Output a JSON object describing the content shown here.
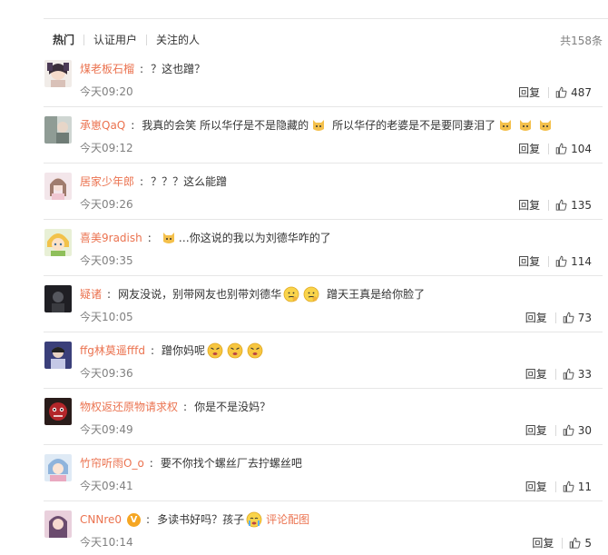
{
  "filter": {
    "tabs": [
      "热门",
      "认证用户",
      "关注的人"
    ],
    "total": "共158条"
  },
  "comments": [
    {
      "user": "煤老板石榴",
      "text": "？这也蹭？",
      "time": "今天09:20",
      "reply": "回复",
      "likes": "487"
    },
    {
      "user": "承崽QaQ",
      "text_a": "我真的会笑 所以华仔是不是隐藏的",
      "text_b": "所以华仔的老婆是不是要同妻泪了",
      "time": "今天09:12",
      "reply": "回复",
      "likes": "104"
    },
    {
      "user": "居家少年郎",
      "text": "？？？这么能蹭",
      "time": "今天09:26",
      "reply": "回复",
      "likes": "135"
    },
    {
      "user": "喜美9radish",
      "text": "…你这说的我以为刘德华咋的了",
      "time": "今天09:35",
      "reply": "回复",
      "likes": "114"
    },
    {
      "user": "疑诸",
      "text_a": "网友没说，别带网友也别带刘德华",
      "text_b": "蹭天王真是给你脸了",
      "time": "今天10:05",
      "reply": "回复",
      "likes": "73"
    },
    {
      "user": "ffg林莫遥fffd",
      "text": "蹭你妈呢",
      "time": "今天09:36",
      "reply": "回复",
      "likes": "33"
    },
    {
      "user": "物权返还原物请求权",
      "text": "你是不是没妈？",
      "time": "今天09:49",
      "reply": "回复",
      "likes": "30"
    },
    {
      "user": "竹帘听雨O_o",
      "text": "要不你找个螺丝厂去拧螺丝吧",
      "time": "今天09:41",
      "reply": "回复",
      "likes": "11"
    },
    {
      "user": "CNNre0",
      "verify": "V",
      "text": "多读书好吗？孩子",
      "pic": "评论配图",
      "time": "今天10:14",
      "reply": "回复",
      "likes": "5"
    }
  ],
  "colors": {
    "username": "#eb7350",
    "time": "#808080",
    "divider": "#e6e6e6"
  }
}
